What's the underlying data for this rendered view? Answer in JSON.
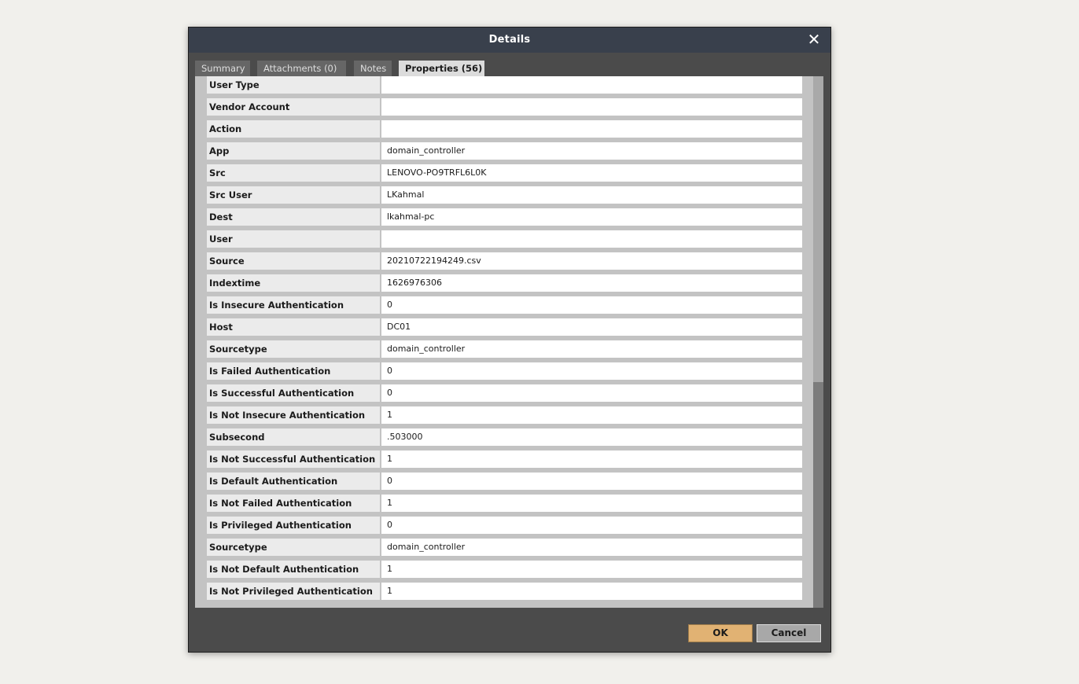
{
  "dialog": {
    "title": "Details",
    "close_icon": "close-icon ✕"
  },
  "tabs": [
    {
      "label": "Summary"
    },
    {
      "label": "Attachments (0)"
    },
    {
      "label": "Notes"
    },
    {
      "label": "Properties (56)",
      "active": true
    }
  ],
  "properties": [
    {
      "label": "User Type",
      "value": ""
    },
    {
      "label": "Vendor Account",
      "value": ""
    },
    {
      "label": "Action",
      "value": ""
    },
    {
      "label": "App",
      "value": "domain_controller"
    },
    {
      "label": "Src",
      "value": "LENOVO-PO9TRFL6L0K"
    },
    {
      "label": "Src User",
      "value": "LKahmal"
    },
    {
      "label": "Dest",
      "value": "lkahmal-pc"
    },
    {
      "label": "User",
      "value": ""
    },
    {
      "label": "Source",
      "value": "20210722194249.csv"
    },
    {
      "label": "Indextime",
      "value": "1626976306"
    },
    {
      "label": "Is Insecure Authentication",
      "value": "0"
    },
    {
      "label": "Host",
      "value": "DC01"
    },
    {
      "label": "Sourcetype",
      "value": "domain_controller"
    },
    {
      "label": "Is Failed Authentication",
      "value": "0"
    },
    {
      "label": "Is Successful Authentication",
      "value": "0"
    },
    {
      "label": "Is Not Insecure Authentication",
      "value": "1"
    },
    {
      "label": "Subsecond",
      "value": ".503000"
    },
    {
      "label": "Is Not Successful Authentication",
      "value": "1"
    },
    {
      "label": "Is Default Authentication",
      "value": "0"
    },
    {
      "label": "Is Not Failed Authentication",
      "value": "1"
    },
    {
      "label": "Is Privileged Authentication",
      "value": "0"
    },
    {
      "label": "Sourcetype",
      "value": "domain_controller"
    },
    {
      "label": "Is Not Default Authentication",
      "value": "1"
    },
    {
      "label": "Is Not Privileged Authentication",
      "value": "1"
    }
  ],
  "buttons": {
    "ok": "OK",
    "cancel": "Cancel"
  },
  "colors": {
    "titlebar": "#39404c",
    "dialog_bg": "#4b4b4b",
    "ok_button": "#e1b273",
    "active_tab": "#dcdcdc"
  }
}
